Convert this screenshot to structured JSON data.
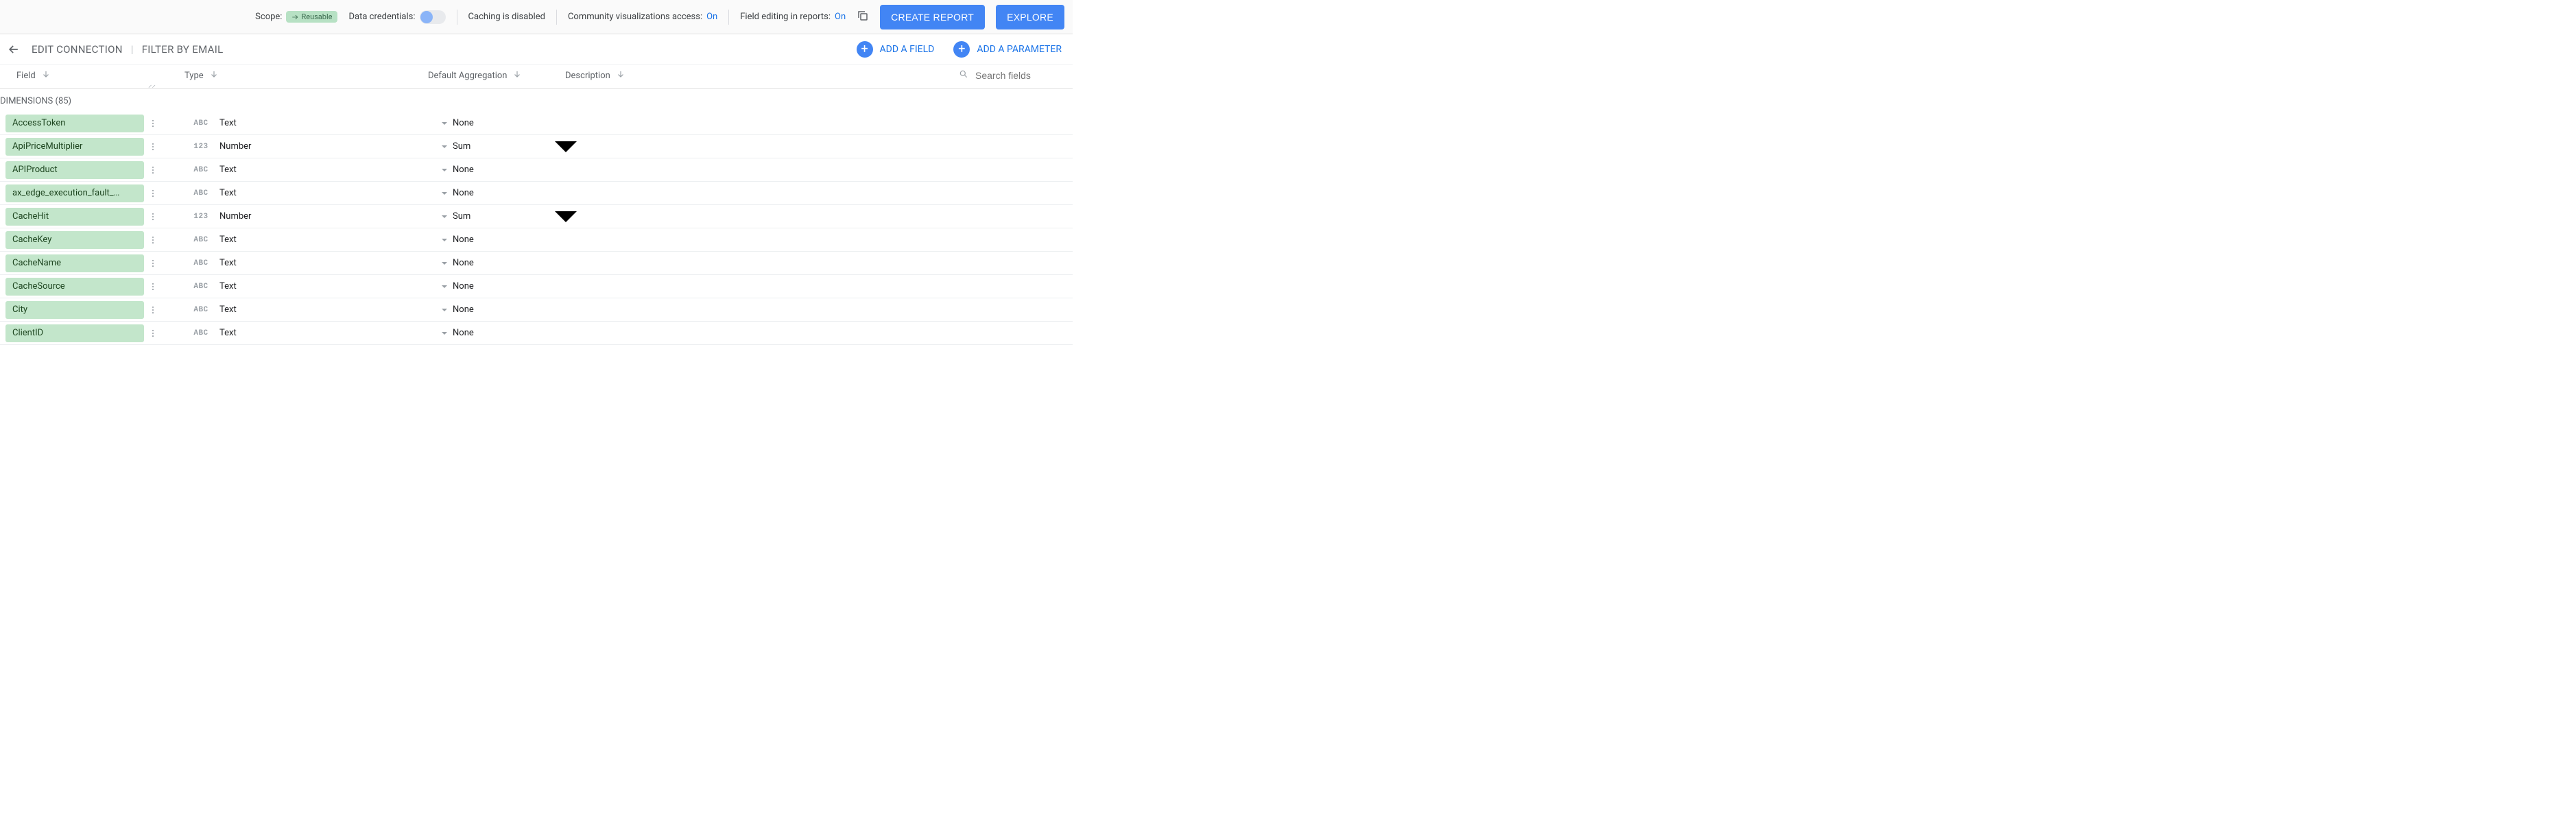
{
  "topbar": {
    "scope_label": "Scope:",
    "scope_value": "Reusable",
    "credentials_label": "Data credentials:",
    "caching_label": "Caching is disabled",
    "community_label": "Community visualizations access:",
    "community_value": "On",
    "field_edit_label": "Field editing in reports:",
    "field_edit_value": "On",
    "create_report": "CREATE REPORT",
    "explore": "EXPLORE"
  },
  "nav": {
    "edit_connection": "EDIT CONNECTION",
    "filter_by_email": "FILTER BY EMAIL",
    "add_field": "ADD A FIELD",
    "add_parameter": "ADD A PARAMETER"
  },
  "headers": {
    "field": "Field",
    "type": "Type",
    "agg": "Default Aggregation",
    "desc": "Description",
    "search_placeholder": "Search fields"
  },
  "section": {
    "dimensions_label": "DIMENSIONS (85)"
  },
  "type_icons": {
    "text": "ABC",
    "number": "123"
  },
  "type_labels": {
    "text": "Text",
    "number": "Number"
  },
  "rows": [
    {
      "name": "AccessToken",
      "type": "text",
      "agg": "None",
      "agg_dd": false
    },
    {
      "name": "ApiPriceMultiplier",
      "type": "number",
      "agg": "Sum",
      "agg_dd": true
    },
    {
      "name": "APIProduct",
      "type": "text",
      "agg": "None",
      "agg_dd": false
    },
    {
      "name": "ax_edge_execution_fault_…",
      "type": "text",
      "agg": "None",
      "agg_dd": false
    },
    {
      "name": "CacheHit",
      "type": "number",
      "agg": "Sum",
      "agg_dd": true
    },
    {
      "name": "CacheKey",
      "type": "text",
      "agg": "None",
      "agg_dd": false
    },
    {
      "name": "CacheName",
      "type": "text",
      "agg": "None",
      "agg_dd": false
    },
    {
      "name": "CacheSource",
      "type": "text",
      "agg": "None",
      "agg_dd": false
    },
    {
      "name": "City",
      "type": "text",
      "agg": "None",
      "agg_dd": false
    },
    {
      "name": "ClientID",
      "type": "text",
      "agg": "None",
      "agg_dd": false
    }
  ]
}
